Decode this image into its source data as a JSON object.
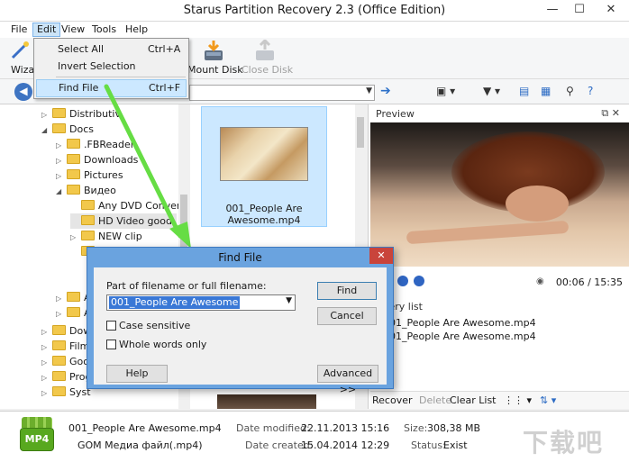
{
  "window": {
    "title": "Starus Partition Recovery 2.3 (Office Edition)",
    "min_glyph": "—",
    "max_glyph": "☐",
    "close_glyph": "✕"
  },
  "menubar": {
    "items": [
      "File",
      "Edit",
      "View",
      "Tools",
      "Help"
    ]
  },
  "toolbar": {
    "wizard_label": "Wiza",
    "mount_disk": "Mount Disk",
    "close_disk": "Close Disk"
  },
  "edit_menu": {
    "items": [
      {
        "label": "Select All",
        "shortcut": "Ctrl+A"
      },
      {
        "label": "Invert Selection",
        "shortcut": ""
      },
      {
        "label": "Find File",
        "shortcut": "Ctrl+F"
      }
    ]
  },
  "tree": {
    "items": [
      {
        "label": "Distributiv",
        "expander": "▷"
      },
      {
        "label": "Docs",
        "expander": "◢"
      },
      {
        "label": ".FBReader",
        "expander": "▷"
      },
      {
        "label": "Downloads",
        "expander": "▷"
      },
      {
        "label": "Pictures",
        "expander": "▷"
      },
      {
        "label": "Видео",
        "expander": "◢"
      },
      {
        "label": "Any DVD Converter",
        "expander": ""
      },
      {
        "label": "HD Video good",
        "expander": ""
      },
      {
        "label": "NEW clip",
        "expander": "▷"
      },
      {
        "label": "",
        "expander": ""
      },
      {
        "label": "A",
        "expander": "▷"
      },
      {
        "label": "A",
        "expander": "▷"
      },
      {
        "label": "Dow",
        "expander": "▷"
      },
      {
        "label": "Film",
        "expander": "▷"
      },
      {
        "label": "Goo",
        "expander": "▷"
      },
      {
        "label": "Prog",
        "expander": "▷"
      },
      {
        "label": "Syst",
        "expander": "▷"
      }
    ]
  },
  "file_list": {
    "selected_file": "001_People Are Awesome.mp4"
  },
  "preview": {
    "title": "Preview",
    "time": "00:06 / 15:35",
    "recovery_list_title": "very list",
    "recovery_items": [
      "001_People Are Awesome.mp4",
      "001_People Are Awesome.mp4"
    ],
    "recover": "Recover",
    "delete": "Delete",
    "clear_list": "Clear List"
  },
  "status": {
    "filename": "001_People Are Awesome.mp4",
    "filetype": "GOM Медиа файл(.mp4)",
    "date_modified_label": "Date modified:",
    "date_modified": "22.11.2013 15:16",
    "date_created_label": "Date created:",
    "date_created": "15.04.2014 12:29",
    "size_label": "Size:",
    "size": "308,38 MB",
    "status_label": "Status:",
    "status": "Exist",
    "icon_text": "MP4"
  },
  "find_dialog": {
    "title": "Find File",
    "close_glyph": "✕",
    "label": "Part of filename or full filename:",
    "value": "001_People Are Awesome",
    "case_sensitive": "Case sensitive",
    "whole_words": "Whole words only",
    "find": "Find",
    "cancel": "Cancel",
    "help": "Help",
    "advanced": "Advanced >>"
  },
  "colors": {
    "accent": "#3e74c2",
    "arrow": "#66dd44",
    "dialog_frame": "#6aa3df"
  }
}
